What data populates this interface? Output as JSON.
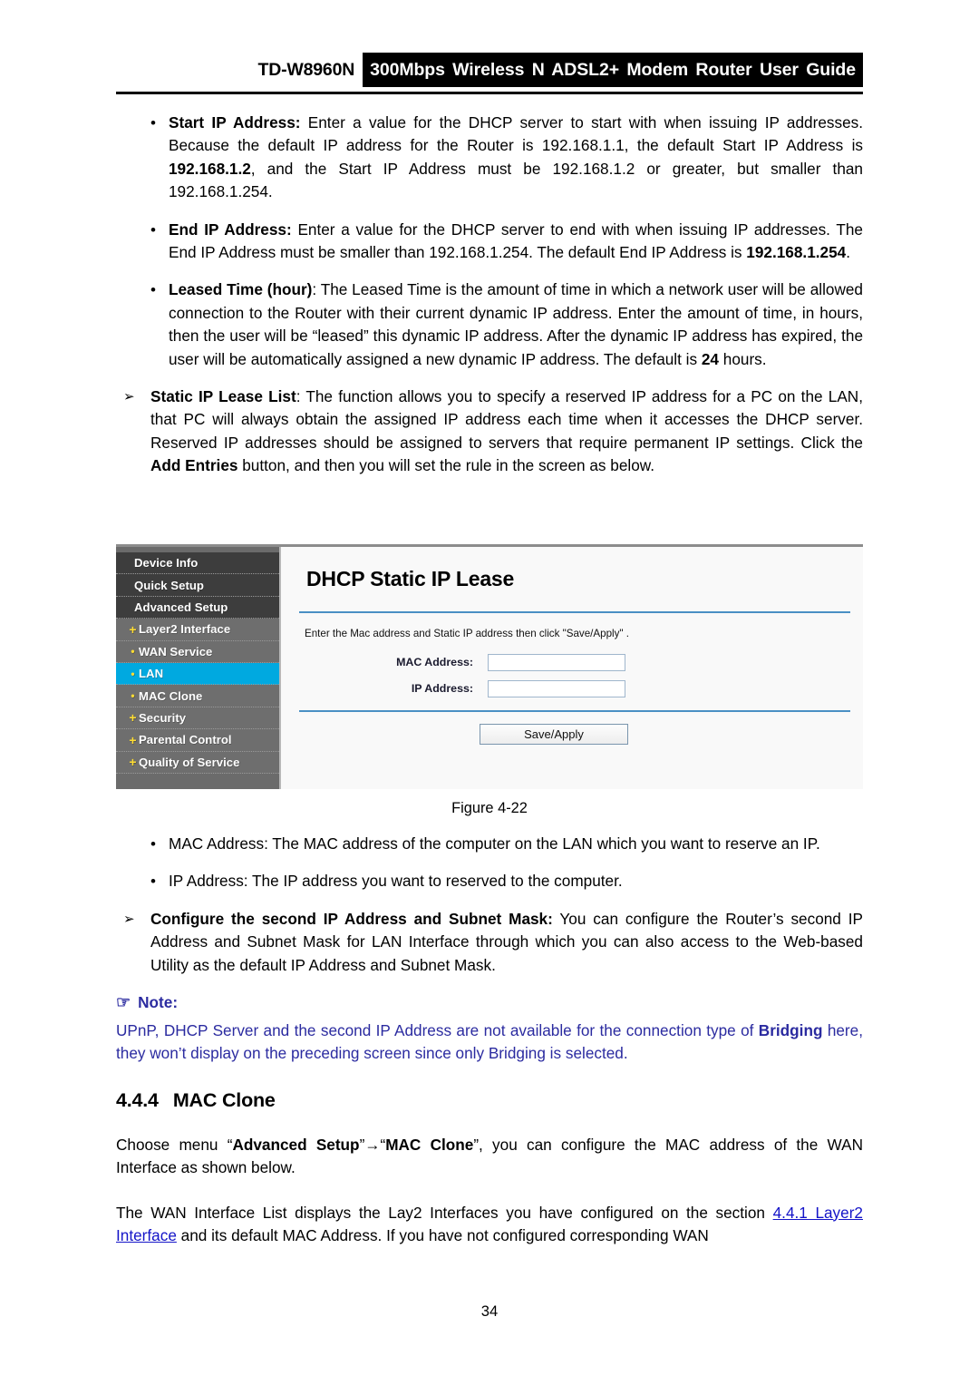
{
  "header": {
    "model": "TD-W8960N",
    "band_title": "300Mbps Wireless N ADSL2+ Modem Router User Guide"
  },
  "bullets": [
    {
      "marker": "•",
      "term": "Start IP Address:",
      "text": " Enter a value for the DHCP server to start with when issuing IP addresses. Because the default IP address for the Router is 192.168.1.1, the default Start IP Address is ",
      "bold_mid": "192.168.1.2",
      "text2": ", and the Start IP Address must be 192.168.1.2 or greater, but smaller than 192.168.1.254."
    },
    {
      "marker": "•",
      "term": "End IP Address:",
      "text": " Enter a value for the DHCP server to end with when issuing IP addresses. The End IP Address must be smaller than 192.168.1.254. The default End IP Address is ",
      "bold_mid": "192.168.1.254",
      "text2": "."
    },
    {
      "marker": "•",
      "term": "Leased Time (hour)",
      "text": ": The Leased Time is the amount of time in which a network user will be allowed connection to the Router with their current dynamic IP address. Enter the amount of time, in hours, then the user will be “leased” this dynamic IP address. After the dynamic IP address has expired, the user will be automatically assigned a new dynamic IP address. The default is ",
      "bold_mid": "24",
      "text2": " hours."
    }
  ],
  "static_lease": {
    "marker": "➢",
    "term": "Static IP Lease List",
    "text1": ": The function allows you to specify a reserved IP address for a PC on the LAN, that PC will always obtain the assigned IP address each time when it accesses the DHCP server. Reserved IP addresses should be assigned to servers that require permanent IP settings. Click the ",
    "bold_mid": "Add Entries",
    "text2": " button, and then you will set the rule in the screen as below."
  },
  "figure": {
    "caption": "Figure 4-22",
    "sidebar": [
      {
        "label": "Device Info",
        "level": "top",
        "mark": "",
        "selected": false
      },
      {
        "label": "Quick Setup",
        "level": "top",
        "mark": "",
        "selected": false
      },
      {
        "label": "Advanced Setup",
        "level": "top",
        "mark": "",
        "selected": false
      },
      {
        "label": "Layer2 Interface",
        "level": "sub",
        "mark": "+",
        "selected": false
      },
      {
        "label": "WAN Service",
        "level": "sub",
        "mark": "•",
        "selected": false
      },
      {
        "label": "LAN",
        "level": "sub",
        "mark": "•",
        "selected": true
      },
      {
        "label": "MAC Clone",
        "level": "sub",
        "mark": "•",
        "selected": false
      },
      {
        "label": "Security",
        "level": "sub",
        "mark": "+",
        "selected": false
      },
      {
        "label": "Parental Control",
        "level": "sub",
        "mark": "+",
        "selected": false
      },
      {
        "label": "Quality of Service",
        "level": "sub",
        "mark": "+",
        "selected": false
      }
    ],
    "panel": {
      "title": "DHCP Static IP Lease",
      "instruction": "Enter the Mac address and Static IP address then click \"Save/Apply\" .",
      "fields": [
        {
          "label": "MAC Address:",
          "value": ""
        },
        {
          "label": "IP Address:",
          "value": ""
        }
      ],
      "save_button": "Save/Apply"
    },
    "colors": {
      "selected_item": "#00a9e0",
      "sidebar_bg": "#6b6b6b",
      "divider": "#4a90c4"
    }
  },
  "lower_bullets": [
    {
      "marker": "•",
      "text": "MAC Address: The MAC address of the computer on the LAN which you want to reserve an IP."
    },
    {
      "marker": "•",
      "text": "IP Address: The IP address you want to reserved to the computer."
    }
  ],
  "configure": {
    "marker": "➢",
    "term": "Configure the second IP Address and Subnet Mask:",
    "text": " You can configure the Router’s second IP Address and Subnet Mask for LAN Interface through which you can also access to the Web-based Utility as the default IP Address and Subnet Mask."
  },
  "note": {
    "hand_icon": "☞",
    "title": "Note:",
    "text1": "UPnP, DHCP Server and the second IP Address are not available for the connection type of ",
    "bold_mid": "Bridging",
    "text2": " here, they won’t display on the preceding screen since only Bridging is selected.",
    "color": "#2b2ba0"
  },
  "section": {
    "number": "4.4.4",
    "title": "MAC Clone"
  },
  "paragraphs": {
    "p1_a": "Choose menu “",
    "p1_b": "Advanced Setup",
    "p1_c": "”→“",
    "p1_d": "MAC Clone",
    "p1_e": "”, you can configure the MAC address of the WAN Interface as shown below.",
    "p2_a": "The WAN Interface List displays the Lay2 Interfaces you have configured on the section ",
    "p2_link": "4.4.1 Layer2 Interface",
    "p2_b": " and its default MAC Address. If you have not configured corresponding WAN"
  },
  "page_number": "34"
}
